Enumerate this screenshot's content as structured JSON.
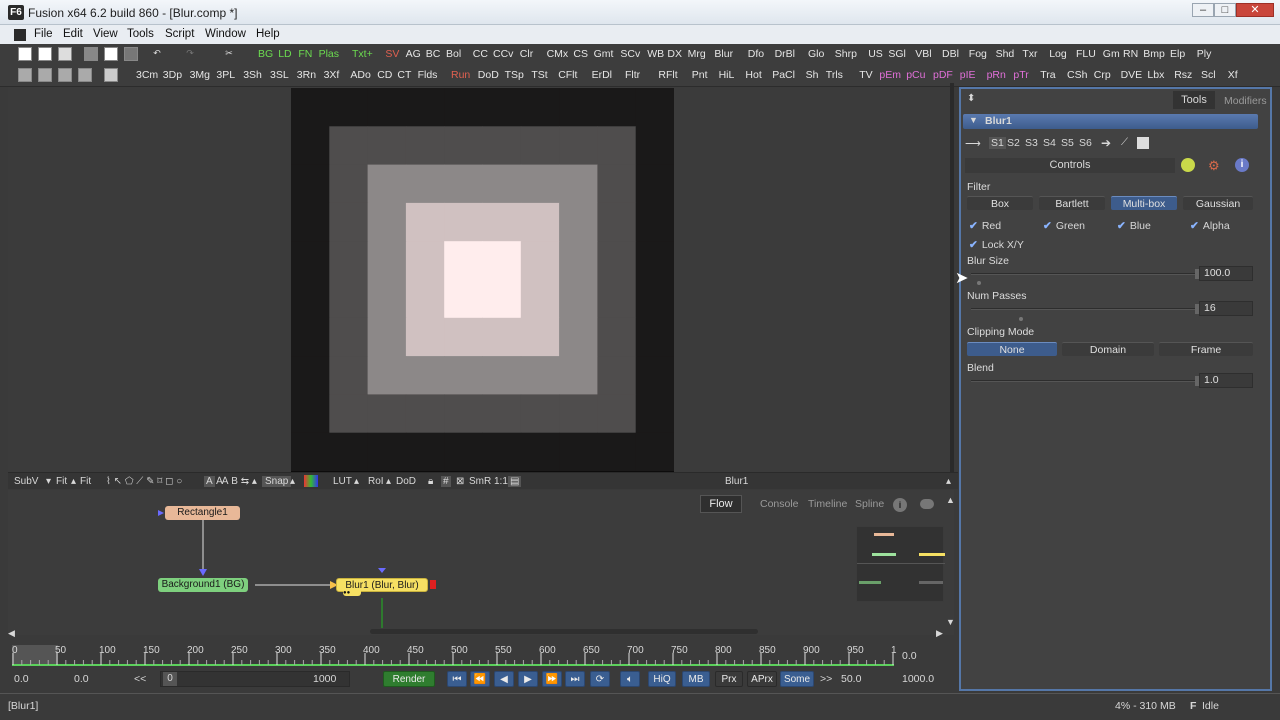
{
  "window": {
    "title": "Fusion x64 6.2 build 860 - [Blur.comp *]",
    "app_icon": "F6"
  },
  "menu": [
    "File",
    "Edit",
    "View",
    "Tools",
    "Script",
    "Window",
    "Help"
  ],
  "toolbar1": [
    {
      "label": "BG",
      "c": "g"
    },
    {
      "label": "LD",
      "c": "g"
    },
    {
      "label": "FN",
      "c": "g"
    },
    {
      "label": "Plas",
      "c": "g"
    },
    {
      "label": "Txt+",
      "c": "g"
    },
    {
      "label": "SV",
      "c": "r"
    },
    {
      "label": "AG"
    },
    {
      "label": "BC"
    },
    {
      "label": "Bol"
    },
    {
      "label": "CC"
    },
    {
      "label": "CCv"
    },
    {
      "label": "Clr"
    },
    {
      "label": "CMx"
    },
    {
      "label": "CS"
    },
    {
      "label": "Gmt"
    },
    {
      "label": "SCv"
    },
    {
      "label": "WB"
    },
    {
      "label": "DX"
    },
    {
      "label": "Mrg"
    },
    {
      "label": "Blur"
    },
    {
      "label": "Dfo"
    },
    {
      "label": "DrBl"
    },
    {
      "label": "Glo"
    },
    {
      "label": "Shrp"
    },
    {
      "label": "US"
    },
    {
      "label": "SGl"
    },
    {
      "label": "VBl"
    },
    {
      "label": "DBl"
    },
    {
      "label": "Fog"
    },
    {
      "label": "Shd"
    },
    {
      "label": "Txr"
    },
    {
      "label": "Log"
    },
    {
      "label": "FLU"
    },
    {
      "label": "Gm"
    },
    {
      "label": "RN"
    },
    {
      "label": "Bmp"
    },
    {
      "label": "Elp"
    },
    {
      "label": "Ply"
    }
  ],
  "toolbar2": [
    {
      "label": "3Cm"
    },
    {
      "label": "3Dp"
    },
    {
      "label": "3Mg"
    },
    {
      "label": "3PL"
    },
    {
      "label": "3Sh"
    },
    {
      "label": "3SL"
    },
    {
      "label": "3Rn"
    },
    {
      "label": "3Xf"
    },
    {
      "label": "ADo"
    },
    {
      "label": "CD"
    },
    {
      "label": "CT"
    },
    {
      "label": "Flds"
    },
    {
      "label": "Run",
      "c": "r"
    },
    {
      "label": "DoD"
    },
    {
      "label": "TSp"
    },
    {
      "label": "TSt"
    },
    {
      "label": "CFlt"
    },
    {
      "label": "ErDl"
    },
    {
      "label": "Fltr"
    },
    {
      "label": "RFlt"
    },
    {
      "label": "Pnt"
    },
    {
      "label": "HiL"
    },
    {
      "label": "Hot"
    },
    {
      "label": "PaCl"
    },
    {
      "label": "Sh"
    },
    {
      "label": "Trls"
    },
    {
      "label": "TV"
    },
    {
      "label": "pEm",
      "c": "m"
    },
    {
      "label": "pCu",
      "c": "m"
    },
    {
      "label": "pDF",
      "c": "m"
    },
    {
      "label": "pIE",
      "c": "m"
    },
    {
      "label": "pRn",
      "c": "m"
    },
    {
      "label": "pTr",
      "c": "m"
    },
    {
      "label": "Tra"
    },
    {
      "label": "CSh"
    },
    {
      "label": "Crp"
    },
    {
      "label": "DVE"
    },
    {
      "label": "Lbx"
    },
    {
      "label": "Rsz"
    },
    {
      "label": "Scl"
    },
    {
      "label": "Xf"
    }
  ],
  "viewer_bar": {
    "subv": "SubV",
    "fit": "Fit",
    "fit2": "Fit",
    "snap": "Snap",
    "lut": "LUT",
    "roi": "RoI",
    "dod": "DoD",
    "smr": "SmR",
    "ratio": "1:1",
    "label": "Blur1"
  },
  "flow_tabs": [
    "Flow",
    "Console",
    "Timeline",
    "Spline"
  ],
  "nodes": {
    "rectangle": "Rectangle1",
    "background": "Background1 (BG)",
    "blur": "Blur1 (Blur, Blur)"
  },
  "timeline": {
    "ticks": [
      "0",
      "50",
      "100",
      "150",
      "200",
      "250",
      "300",
      "350",
      "400",
      "450",
      "500",
      "550",
      "600",
      "650",
      "700",
      "750",
      "800",
      "850",
      "900",
      "950",
      "1"
    ],
    "end": "0.0"
  },
  "transport": {
    "start": "0.0",
    "current": "0.0",
    "back": "<<",
    "frame": "0",
    "end_field": "1000",
    "render": "Render",
    "hiq": "HiQ",
    "mb": "MB",
    "prx": "Prx",
    "aprx": "APrx",
    "some": "Some",
    "fwd": ">>",
    "step": "50.0",
    "total": "1000.0"
  },
  "status": {
    "left": "[Blur1]",
    "mem": "4% - 310 MB",
    "state": "Idle"
  },
  "panel": {
    "tabs": [
      "Tools",
      "Modifiers"
    ],
    "tool": "Blur1",
    "slots": [
      "S1",
      "S2",
      "S3",
      "S4",
      "S5",
      "S6"
    ],
    "controls": "Controls",
    "filter_label": "Filter",
    "filters": [
      "Box",
      "Bartlett",
      "Multi-box",
      "Gaussian"
    ],
    "filter_selected": "Multi-box",
    "channels": [
      "Red",
      "Green",
      "Blue",
      "Alpha"
    ],
    "lock": "Lock X/Y",
    "blur_size_label": "Blur Size",
    "blur_size": "100.0",
    "num_passes_label": "Num Passes",
    "num_passes": "16",
    "clipping_label": "Clipping Mode",
    "clipping": [
      "None",
      "Domain",
      "Frame"
    ],
    "clipping_selected": "None",
    "blend_label": "Blend",
    "blend": "1.0"
  },
  "colors": {
    "accent": "#3d5c8c",
    "panel_border": "#5577a8",
    "node_bg": "#7ed07e",
    "node_rect": "#e8b898",
    "node_blur": "#f6e063"
  }
}
